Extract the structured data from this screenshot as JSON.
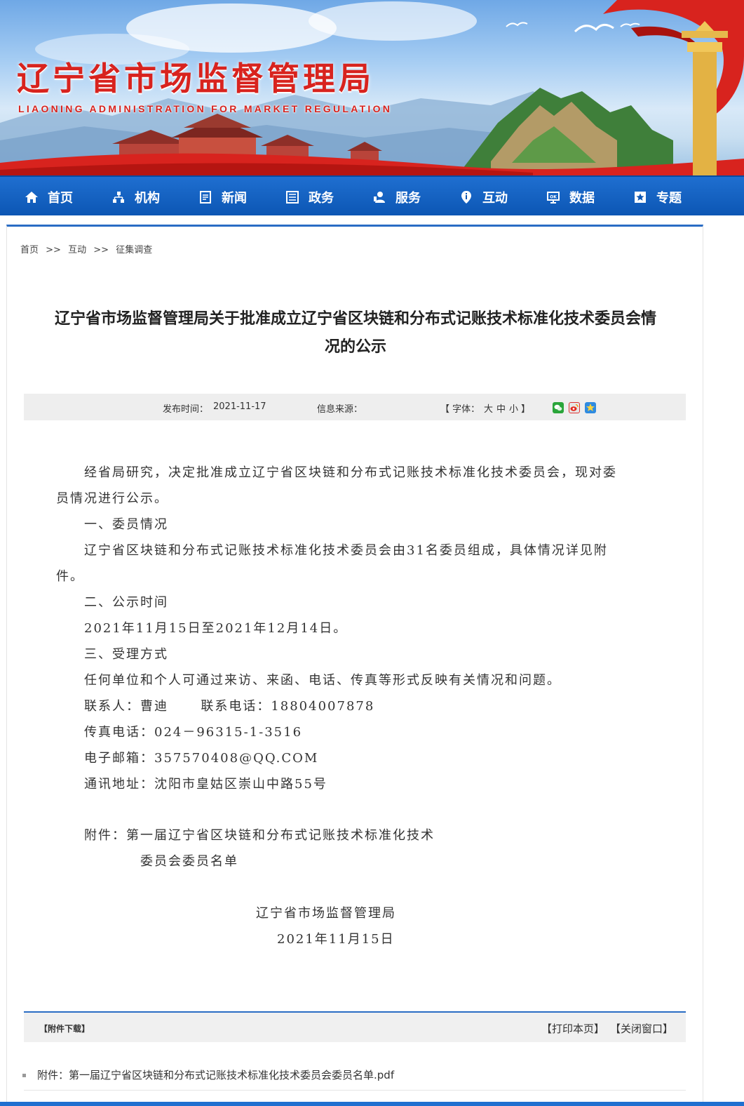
{
  "header": {
    "title": "辽宁省市场监督管理局",
    "subtitle": "LIAONING ADMINISTRATION FOR MARKET REGULATION"
  },
  "nav": [
    {
      "label": "首页",
      "icon": "home-icon"
    },
    {
      "label": "机构",
      "icon": "org-chart-icon"
    },
    {
      "label": "新闻",
      "icon": "news-icon"
    },
    {
      "label": "政务",
      "icon": "list-icon"
    },
    {
      "label": "服务",
      "icon": "service-icon"
    },
    {
      "label": "互动",
      "icon": "info-icon"
    },
    {
      "label": "数据",
      "icon": "data-icon"
    },
    {
      "label": "专题",
      "icon": "star-icon"
    }
  ],
  "breadcrumb": {
    "home": "首页",
    "sep": ">>",
    "section": "互动",
    "page": "征集调查"
  },
  "article": {
    "title_line1": "辽宁省市场监督管理局关于批准成立辽宁省区块链和分布式记账技术标准化技术委员会情",
    "title_line2": "况的公示",
    "publish_label": "发布时间：",
    "publish_date": "2021-11-17",
    "source_label": "信息来源：",
    "source_value": "",
    "font_open": "【 字体：",
    "font_large": "大",
    "font_medium": "中",
    "font_small": "小",
    "font_close": "】",
    "share_icons": [
      "wechat-icon",
      "weibo-icon",
      "qzone-icon"
    ],
    "paragraphs": [
      "经省局研究，决定批准成立辽宁省区块链和分布式记账技术标准化技术委员会，现对委",
      "员情况进行公示。",
      "一、委员情况",
      "辽宁省区块链和分布式记账技术标准化技术委员会由31名委员组成，具体情况详见附",
      "件。",
      "二、公示时间",
      "2021年11月15日至2021年12月14日。",
      "三、受理方式",
      "任何单位和个人可通过来访、来函、电话、传真等形式反映有关情况和问题。",
      "联系人：曹迪      联系电话：18804007878",
      "传真电话：024－96315-1-3516",
      "电子邮箱：357570408@QQ.COM",
      "通讯地址：沈阳市皇姑区崇山中路55号",
      "附件：第一届辽宁省区块链和分布式记账技术标准化技术",
      "委员会委员名单",
      "辽宁省市场监督管理局",
      "2021年11月15日"
    ]
  },
  "attachments": {
    "label": "【附件下载】",
    "print": "【打印本页】",
    "close": "【关闭窗口】",
    "file": "附件：第一届辽宁省区块链和分布式记账技术标准化技术委员会委员名单.pdf"
  },
  "colors": {
    "brand_red": "#d8231e",
    "nav_blue": "#0c56b4",
    "accent_blue": "#2a6dc4"
  }
}
